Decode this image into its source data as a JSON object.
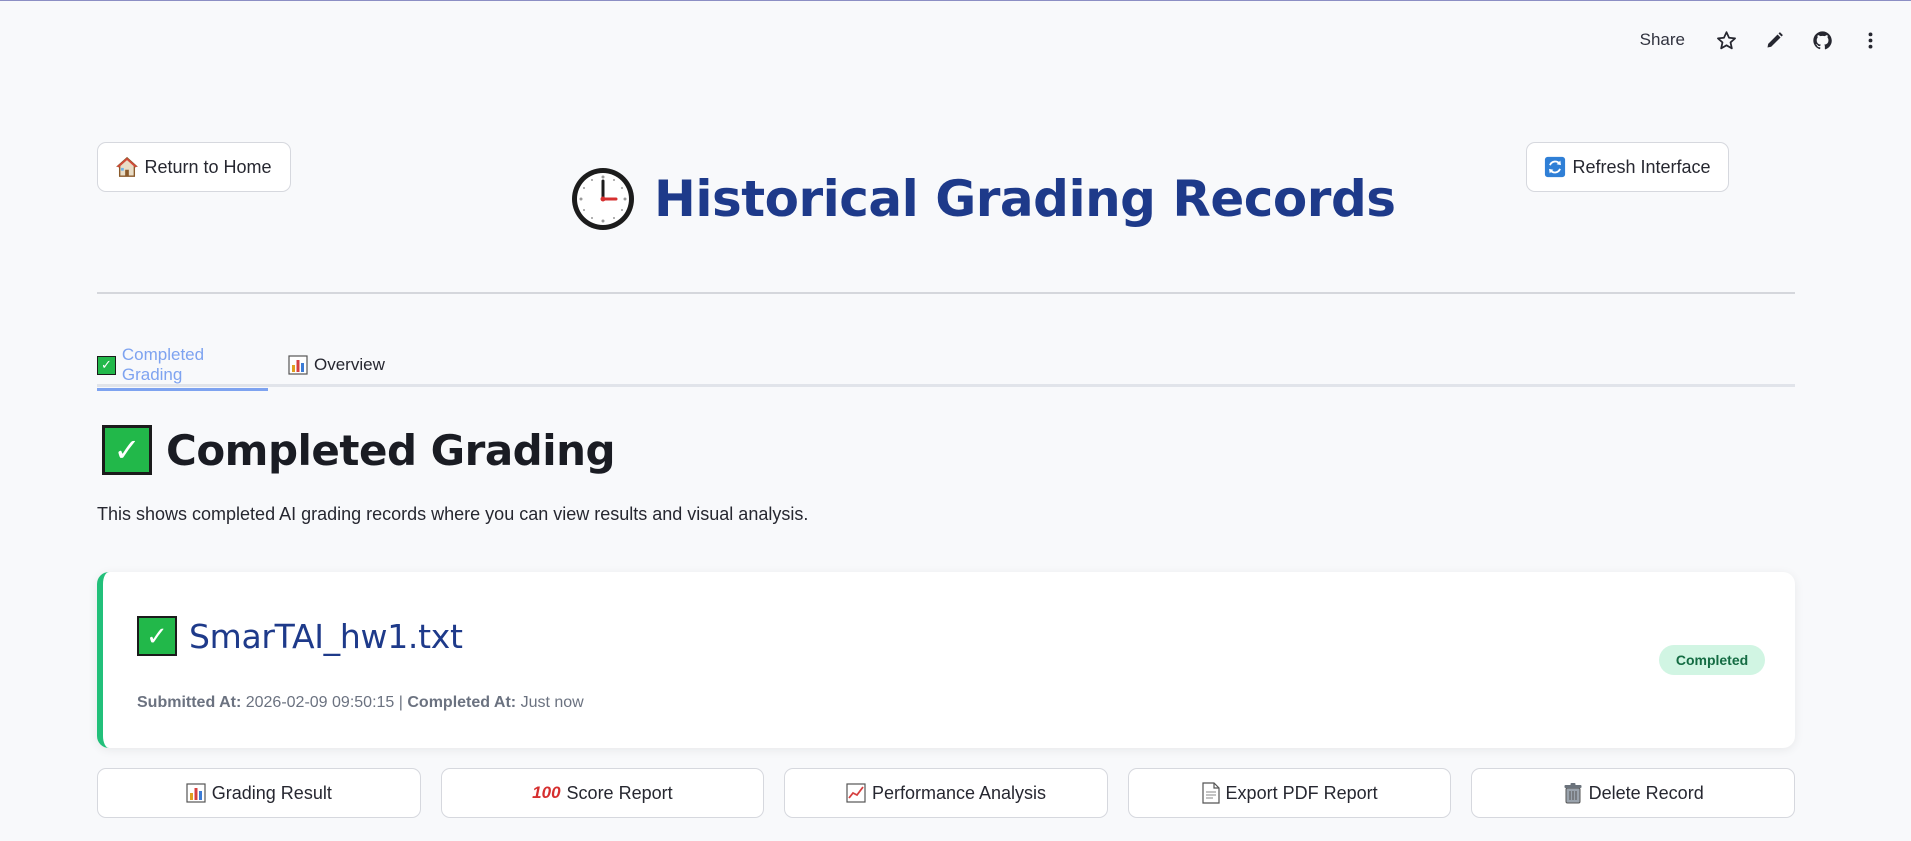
{
  "toolbar": {
    "share_label": "Share",
    "icons": [
      "star-icon",
      "edit-pencil-icon",
      "github-icon",
      "more-vertical-icon"
    ]
  },
  "header": {
    "home_button": "Return to Home",
    "refresh_button": "Refresh Interface",
    "page_title": "Historical Grading Records",
    "icons": {
      "home": "house-icon",
      "refresh": "refresh-icon",
      "title": "clock-icon"
    }
  },
  "tabs": [
    {
      "label": "Completed Grading",
      "icon": "check-box-icon",
      "active": true
    },
    {
      "label": "Overview",
      "icon": "bar-chart-icon",
      "active": false
    }
  ],
  "section": {
    "title": "Completed Grading",
    "description": "This shows completed AI grading records where you can view results and visual analysis."
  },
  "record": {
    "file_name": "SmarTAI_hw1.txt",
    "submitted_label": "Submitted At:",
    "submitted_value": "2026-02-09 09:50:15",
    "separator": "|",
    "completed_label": "Completed At:",
    "completed_value": "Just now",
    "status": "Completed",
    "accent_color": "#22c07a"
  },
  "actions": [
    {
      "label": "Grading Result",
      "icon": "bar-chart-icon"
    },
    {
      "label": "Score Report",
      "icon": "hundred-points-icon",
      "icon_text": "100"
    },
    {
      "label": "Performance Analysis",
      "icon": "trend-chart-icon"
    },
    {
      "label": "Export PDF Report",
      "icon": "document-icon"
    },
    {
      "label": "Delete Record",
      "icon": "trash-icon"
    }
  ],
  "colors": {
    "title": "#1e3a8a",
    "active_tab": "#7ea3f0",
    "badge_bg": "#d1f5e3",
    "badge_text": "#146c43"
  }
}
